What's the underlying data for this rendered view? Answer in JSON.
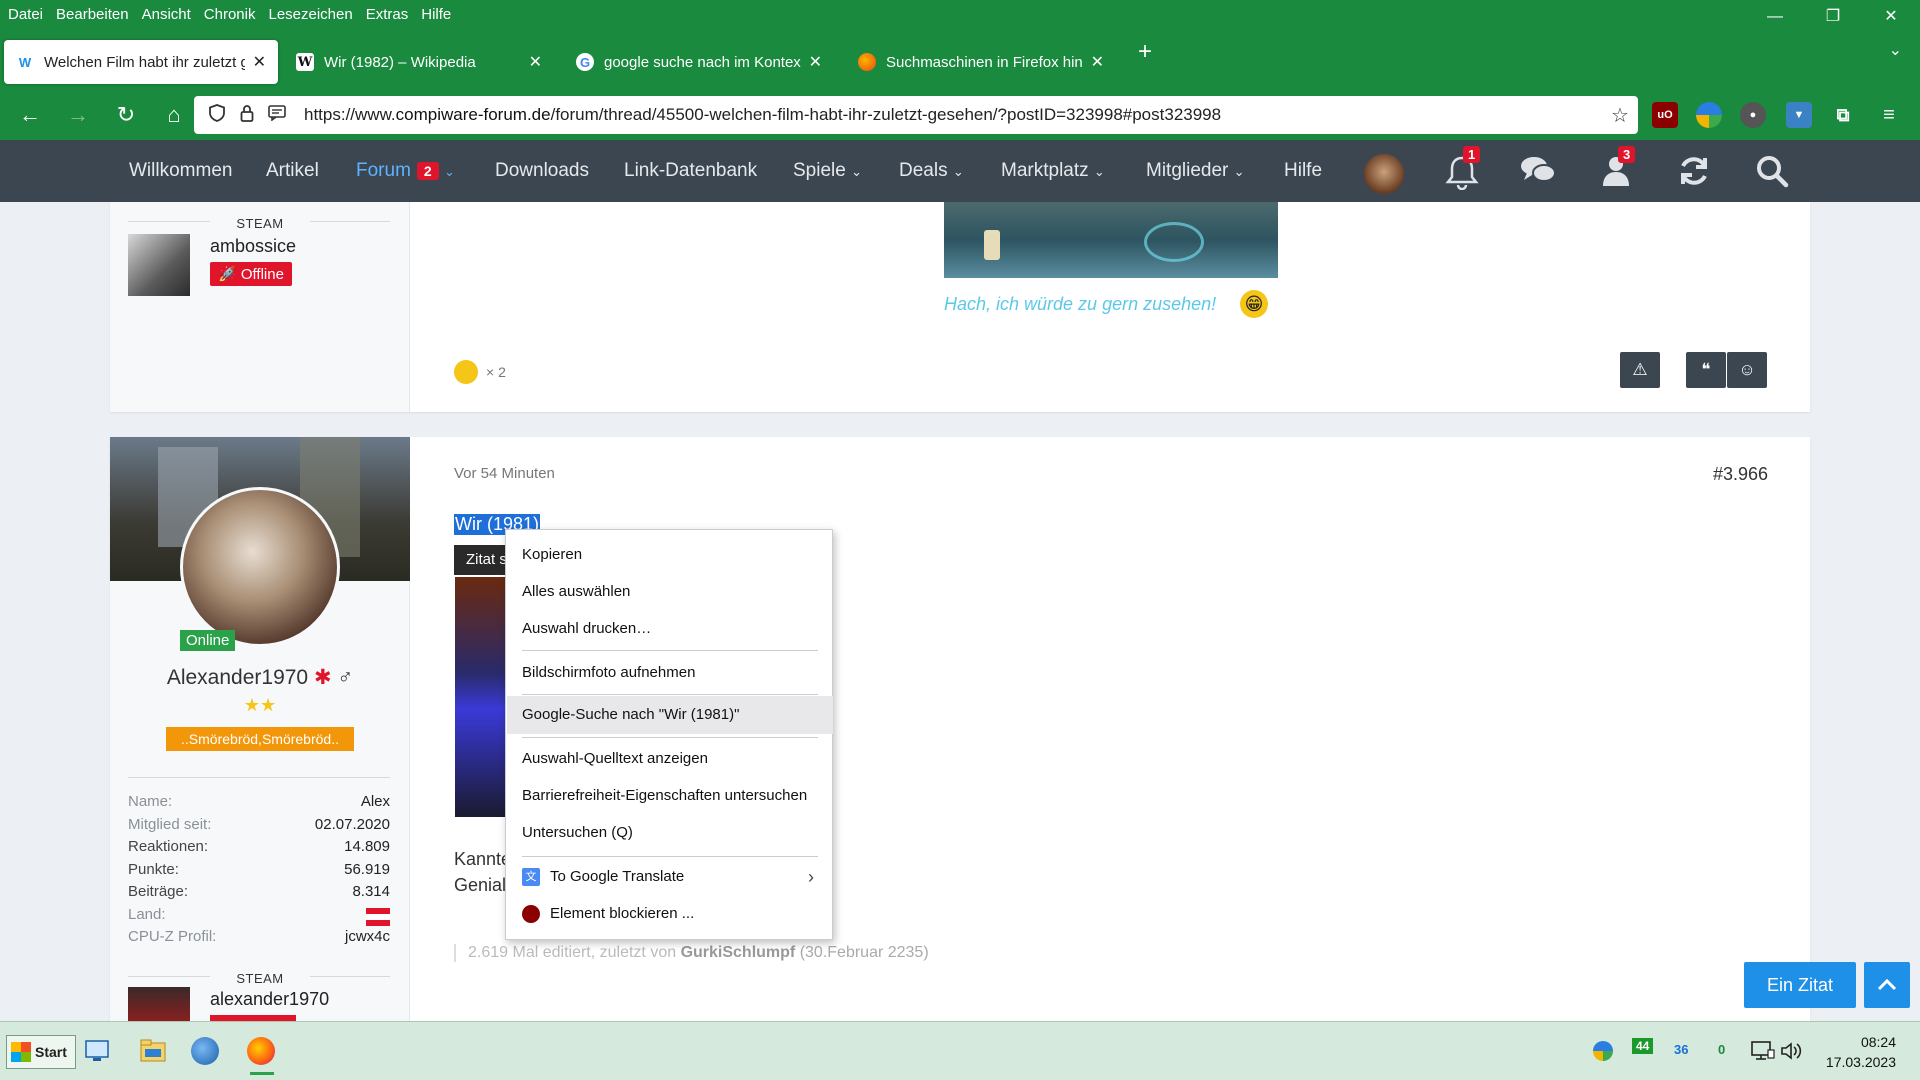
{
  "menubar": {
    "items": [
      "Datei",
      "Bearbeiten",
      "Ansicht",
      "Chronik",
      "Lesezeichen",
      "Extras",
      "Hilfe"
    ]
  },
  "window_controls": {
    "minimize": "—",
    "restore": "❐",
    "close": "✕"
  },
  "tabs": [
    {
      "title": "Welchen Film habt ihr zuletzt ge",
      "icon": "W",
      "close": "✕"
    },
    {
      "title": "Wir (1982) – Wikipedia",
      "icon": "W",
      "close": "✕"
    },
    {
      "title": "google suche nach im Kontextn",
      "icon": "G",
      "close": "✕"
    },
    {
      "title": "Suchmaschinen in Firefox hinzu",
      "icon": "",
      "close": "✕"
    }
  ],
  "new_tab": "+",
  "tab_list": "⌄",
  "nav": {
    "back": "←",
    "forward": "→",
    "reload": "↻",
    "home": "⌂"
  },
  "url": {
    "prefix": "https://www.",
    "domain": "compiware-forum.de",
    "path": "/forum/thread/45500-welchen-film-habt-ihr-zuletzt-gesehen/?postID=323998#post323998"
  },
  "sitenav": {
    "items": [
      "Willkommen",
      "Artikel",
      "Forum",
      "Downloads",
      "Link-Datenbank",
      "Spiele",
      "Deals",
      "Marktplatz",
      "Mitglieder",
      "Hilfe"
    ],
    "forum_badge": "2",
    "notifications_count": "1",
    "user_requests_count": "3"
  },
  "post1": {
    "steam_label": "STEAM",
    "steam_user": "ambossice",
    "steam_status": "Offline",
    "caption": "Hach, ich würde zu gern zusehen!",
    "reaction_count": "× 2"
  },
  "post2": {
    "online": "Online",
    "username": "Alexander1970",
    "rank_title": "..Smörebröd,Smörebröd..",
    "time": "Vor 54 Minuten",
    "post_number": "#3.966",
    "selected_text": "Wir (1981)",
    "quote_button": "Zitat s",
    "body_line1": "Kannte",
    "body_line2": "Genial",
    "edit_note_prefix": "2.619 Mal editiert, zuletzt von ",
    "edit_note_user": "GurkiSchlumpf",
    "edit_note_date": " (30.Februar 2235)",
    "stats": [
      {
        "label": "Name:",
        "value": "Alex"
      },
      {
        "label": "Mitglied seit:",
        "value": "02.07.2020"
      },
      {
        "label": "Reaktionen:",
        "value": "14.809"
      },
      {
        "label": "Punkte:",
        "value": "56.919"
      },
      {
        "label": "Beiträge:",
        "value": "8.314"
      },
      {
        "label": "Land:",
        "value": ""
      },
      {
        "label": "CPU-Z Profil:",
        "value": "jcwx4c"
      }
    ],
    "steam_label": "STEAM",
    "steam_user": "alexander1970"
  },
  "context_menu": {
    "items": [
      "Kopieren",
      "Alles auswählen",
      "Auswahl drucken…",
      "Bildschirmfoto aufnehmen",
      "Google-Suche nach \"Wir (1981)\"",
      "Auswahl-Quelltext anzeigen",
      "Barrierefreiheit-Eigenschaften untersuchen",
      "Untersuchen (Q)",
      "To Google Translate",
      "Element blockieren ..."
    ]
  },
  "floating": {
    "quote_button": "Ein Zitat",
    "scroll_top": "^"
  },
  "taskbar": {
    "start": "Start",
    "tray_a": "44",
    "tray_b": "36",
    "tray_c": "0",
    "time": "08:24",
    "date": "17.03.2023"
  },
  "colors": {
    "browser_green": "#1a8a3e",
    "site_nav": "#3c4650",
    "accent_blue": "#1e90e8",
    "badge_red": "#e0142b"
  }
}
